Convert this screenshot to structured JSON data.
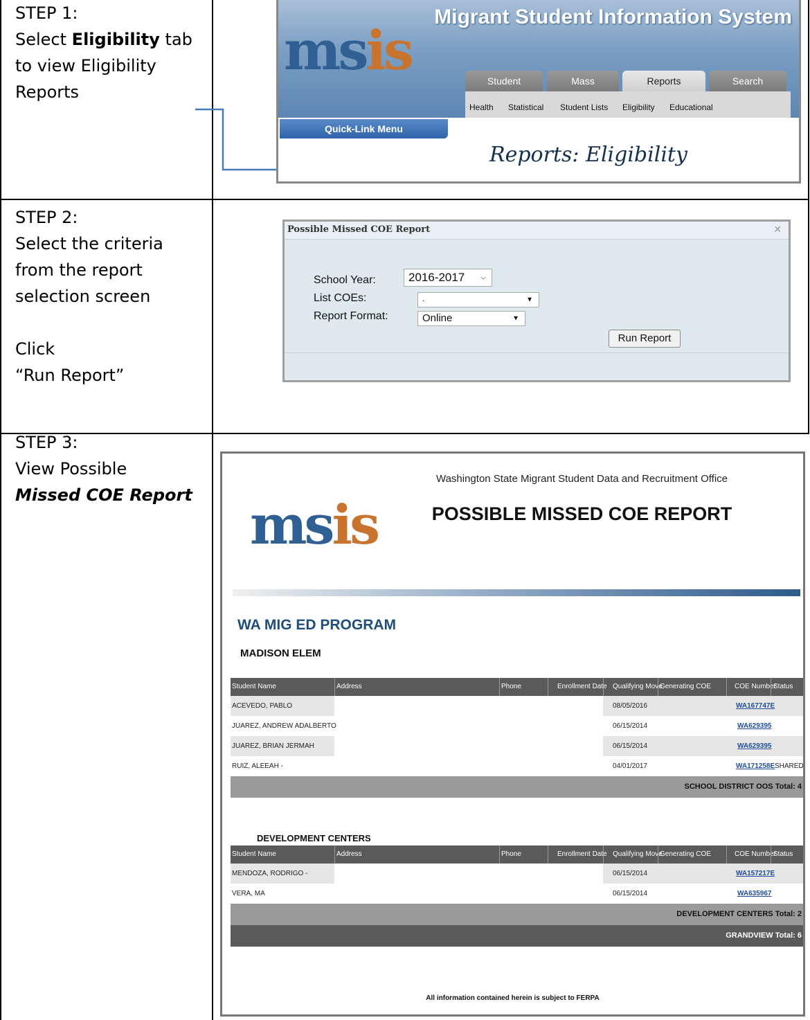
{
  "steps": [
    {
      "label": "STEP 1:",
      "line1": "Select ",
      "bold": "Eligibility",
      "line1b": " tab",
      "line2": "to view Eligibility",
      "line3": "Reports"
    },
    {
      "label": "STEP 2:",
      "line1": "Select the criteria",
      "line2": "from the report",
      "line3": "selection screen",
      "line4": "Click",
      "line5": "“Run Report”"
    },
    {
      "label": "STEP 3:",
      "line1": "View Possible",
      "line2": "Missed COE Report"
    }
  ],
  "msis": {
    "logo_a": "ms",
    "logo_b": "is",
    "title": "Migrant Student Information System",
    "tabs": [
      "Student",
      "Mass",
      "Reports",
      "Search"
    ],
    "active_tab": "Reports",
    "subtabs": [
      "Health",
      "Statistical",
      "Student Lists",
      "Eligibility",
      "Educational"
    ],
    "quick_link": "Quick-Link Menu",
    "page_heading": "Reports: Eligibility"
  },
  "dialog": {
    "title": "Possible Missed COE Report",
    "close": "✕",
    "school_year_label": "School Year:",
    "school_year_value": "2016-2017",
    "list_coes_label": "List COEs:",
    "list_coes_value": ".",
    "report_format_label": "Report Format:",
    "report_format_value": "Online",
    "run_button": "Run Report"
  },
  "report": {
    "office": "Washington State Migrant Student Data and Recruitment Office",
    "title": "POSSIBLE MISSED COE REPORT",
    "program": "WA MIG ED PROGRAM",
    "columns": [
      "Student Name",
      "Address",
      "Phone",
      "Enrollment Date",
      "Qualifying Move",
      "Generating COE",
      "COE Number",
      "Status"
    ],
    "sections": [
      {
        "name": "MADISON ELEM",
        "rows": [
          {
            "name": "ACEVEDO, PABLO",
            "move": "08/05/2016",
            "coe": "WA167747E",
            "status": ""
          },
          {
            "name": "JUAREZ, ANDREW ADALBERTO",
            "move": "06/15/2014",
            "coe": "WA629395",
            "status": ""
          },
          {
            "name": "JUAREZ, BRIAN JERMAH",
            "move": "06/15/2014",
            "coe": "WA629395",
            "status": ""
          },
          {
            "name": "RUIZ, ALEEAH -",
            "move": "04/01/2017",
            "coe": "WA171258E",
            "status": "SHARED"
          }
        ],
        "total": "SCHOOL DISTRICT OOS Total: 4"
      },
      {
        "name": "DEVELOPMENT CENTERS",
        "rows": [
          {
            "name": "MENDOZA, RODRIGO -",
            "move": "06/15/2014",
            "coe": "WA157217E",
            "status": ""
          },
          {
            "name": "VERA, MA",
            "move": "06/15/2014",
            "coe": "WA635967",
            "status": ""
          }
        ],
        "total": "DEVELOPMENT CENTERS Total: 2"
      }
    ],
    "grand_total": "GRANDVIEW Total: 6",
    "footer": "All information contained herein is subject to FERPA"
  }
}
